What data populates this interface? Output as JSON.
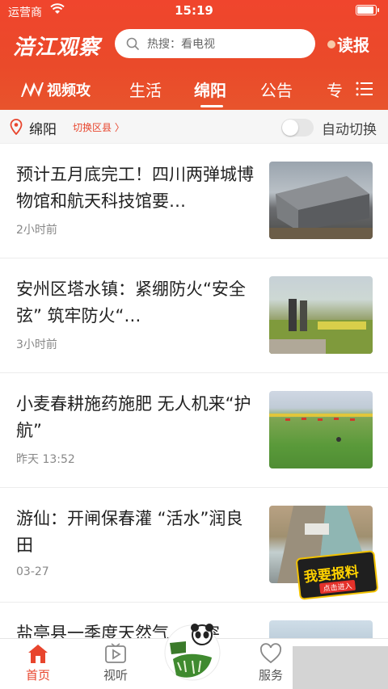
{
  "statusbar": {
    "carrier": "运营商",
    "time": "15:19"
  },
  "header": {
    "logo": "涪江观察",
    "search_placeholder": "热搜：看电视",
    "read_paper": "读报"
  },
  "tabs": {
    "video": "视频攻",
    "items": [
      "生活",
      "绵阳",
      "公告",
      "专"
    ],
    "active": "绵阳"
  },
  "location": {
    "city": "绵阳",
    "switch_label": "切换区县 〉",
    "auto_switch_label": "自动切换",
    "auto_switch_on": false
  },
  "news": [
    {
      "title": "预计五月底完工！四川两弹城博物馆和航天科技馆要…",
      "time": "2小时前"
    },
    {
      "title": "安州区塔水镇：紧绷防火“安全弦” 筑牢防火“…",
      "time": "3小时前"
    },
    {
      "title": "小麦春耕施药施肥 无人机来“护航”",
      "time": "昨天 13:52"
    },
    {
      "title": "游仙：开闸保春灌 “活水”润良田",
      "time": "03-27"
    },
    {
      "title": "盐亭县一季度天然气…量突"
    }
  ],
  "baoliao": {
    "title": "我要报料",
    "sub": "点击进入"
  },
  "tabbar": {
    "items": [
      {
        "label": "首页",
        "icon": "home-icon",
        "active": true
      },
      {
        "label": "视听",
        "icon": "play-icon",
        "active": false
      },
      {
        "label": "服务",
        "icon": "heart-icon",
        "active": false
      }
    ],
    "panda_text": "熊猫家园"
  },
  "colors": {
    "brand_red": "#e8452d",
    "text": "#222222",
    "muted": "#888888"
  }
}
